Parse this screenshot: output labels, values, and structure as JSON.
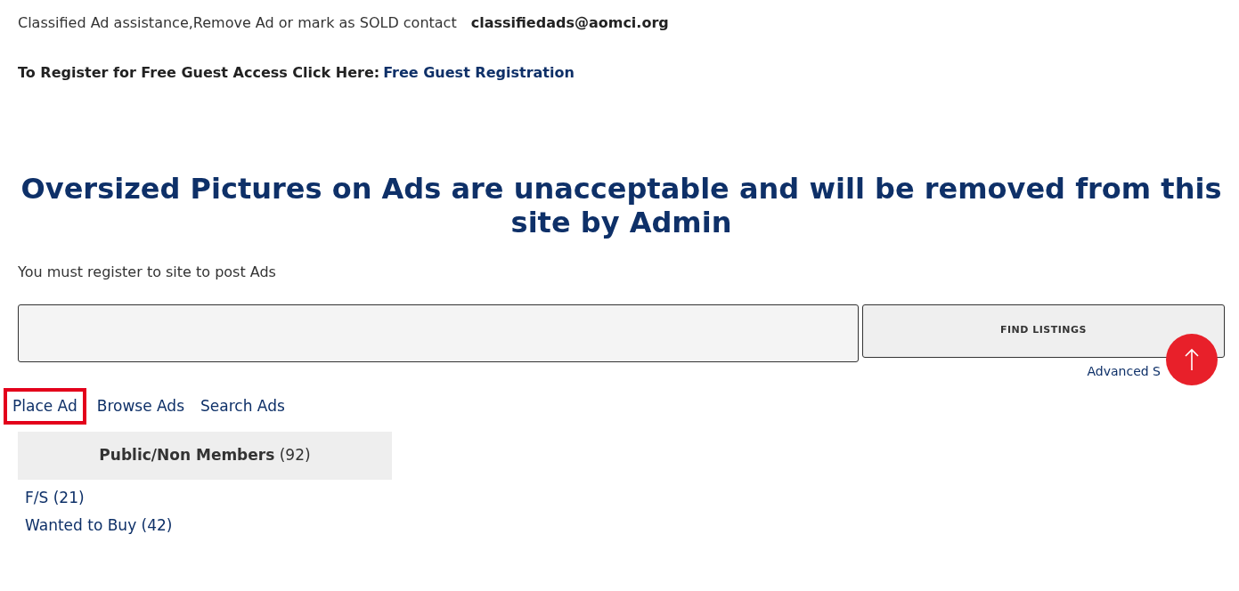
{
  "notice": {
    "text": "Classified Ad assistance,Remove Ad or mark as SOLD contact",
    "email": "classifiedads@aomci.org"
  },
  "register": {
    "text": "To Register for Free Guest Access Click Here:",
    "link": "Free Guest Registration"
  },
  "headline": "Oversized Pictures on Ads are unacceptable and will be removed from this site by Admin",
  "post_note": "You must register to site to post Ads",
  "search": {
    "button": "FIND LISTINGS",
    "advanced_link": "Advanced S"
  },
  "nav_links": [
    {
      "label": "Place Ad",
      "highlighted": true
    },
    {
      "label": "Browse Ads",
      "highlighted": false
    },
    {
      "label": "Search Ads",
      "highlighted": false
    }
  ],
  "category": {
    "title": "Public/Non Members",
    "count": "(92)",
    "items": [
      {
        "label": "F/S",
        "count": "(21)"
      },
      {
        "label": "Wanted to Buy",
        "count": "(42)"
      }
    ]
  }
}
